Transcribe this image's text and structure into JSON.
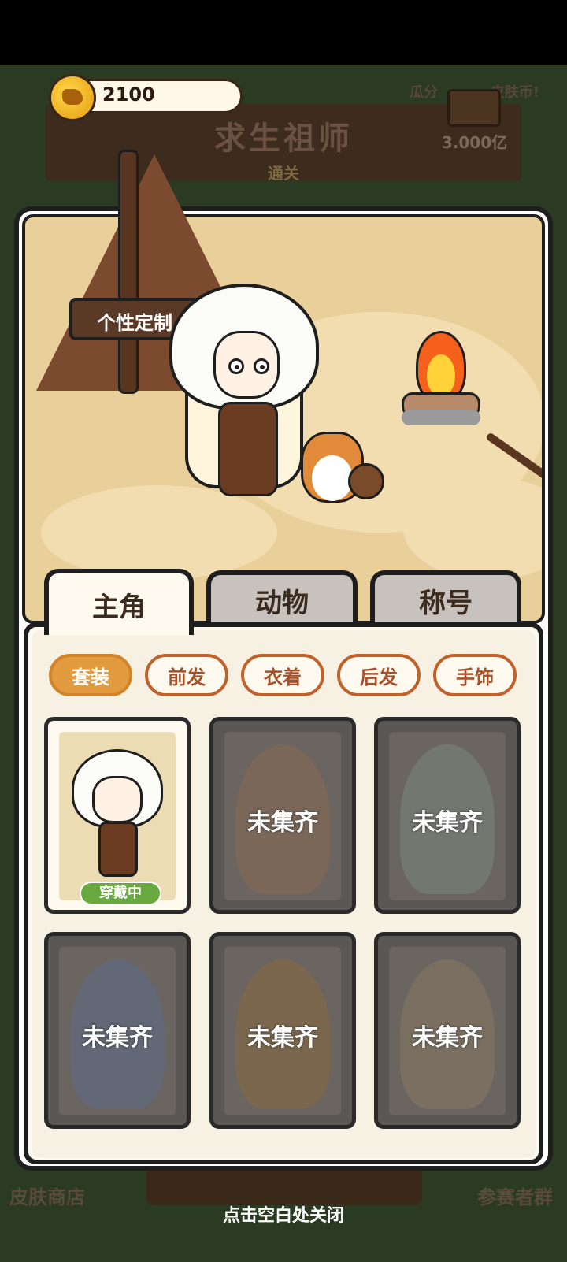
{
  "coins": {
    "value": "2100",
    "icon": "coin-icon"
  },
  "stage_sign": {
    "title": "求生祖师",
    "subtitle": "通关"
  },
  "reward": {
    "left_label": "瓜分",
    "right_label": "皮肤币!",
    "amount": "3.000亿",
    "icon": "treasure-chest-icon"
  },
  "scene": {
    "sign_text": "个性定制"
  },
  "tabs": [
    {
      "label": "主角",
      "active": true
    },
    {
      "label": "动物",
      "active": false
    },
    {
      "label": "称号",
      "active": false
    }
  ],
  "categories": [
    {
      "label": "套装",
      "active": true
    },
    {
      "label": "前发",
      "active": false
    },
    {
      "label": "衣着",
      "active": false
    },
    {
      "label": "后发",
      "active": false
    },
    {
      "label": "手饰",
      "active": false
    }
  ],
  "outfits": [
    {
      "status": "owned",
      "badge": "穿戴中"
    },
    {
      "status": "locked",
      "label": "未集齐",
      "theme": "fox-ears"
    },
    {
      "status": "locked",
      "label": "未集齐",
      "theme": "flower-bow"
    },
    {
      "status": "locked",
      "label": "未集齐",
      "theme": "mermaid"
    },
    {
      "status": "locked",
      "label": "未集齐",
      "theme": "witch-hat"
    },
    {
      "status": "locked",
      "label": "未集齐",
      "theme": "tiger-ribbon"
    }
  ],
  "footer": {
    "left": "皮肤商店",
    "right": "参赛者群",
    "close_hint": "点击空白处关闭"
  },
  "colors": {
    "accent": "#e29b3f",
    "chip_border": "#c1622d",
    "badge_green": "#6aa93f",
    "locked_card": "#5b5754"
  }
}
